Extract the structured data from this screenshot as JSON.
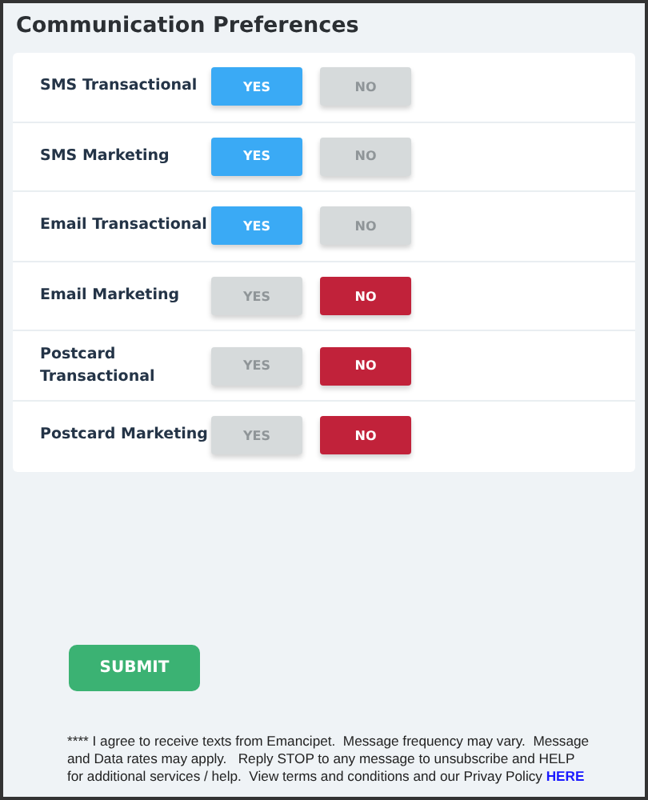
{
  "title": "Communication Preferences",
  "preferences": [
    {
      "label": "SMS Transactional",
      "options": [
        {
          "label": "YES",
          "kind": "yes",
          "selected": true
        },
        {
          "label": "NO",
          "kind": "no",
          "selected": false
        }
      ]
    },
    {
      "label": "SMS Marketing",
      "options": [
        {
          "label": "YES",
          "kind": "yes",
          "selected": true
        },
        {
          "label": "NO",
          "kind": "no",
          "selected": false
        }
      ]
    },
    {
      "label": "Email Transactional",
      "options": [
        {
          "label": "YES",
          "kind": "yes",
          "selected": true
        },
        {
          "label": "NO",
          "kind": "no",
          "selected": false
        }
      ]
    },
    {
      "label": "Email Marketing",
      "options": [
        {
          "label": "YES",
          "kind": "yes",
          "selected": false
        },
        {
          "label": "NO",
          "kind": "no",
          "selected": true
        }
      ]
    },
    {
      "label": "Postcard Transactional",
      "options": [
        {
          "label": "YES",
          "kind": "yes",
          "selected": false
        },
        {
          "label": "NO",
          "kind": "no",
          "selected": true
        }
      ]
    },
    {
      "label": "Postcard Marketing",
      "options": [
        {
          "label": "YES",
          "kind": "yes",
          "selected": false
        },
        {
          "label": "NO",
          "kind": "no",
          "selected": true
        }
      ]
    }
  ],
  "submit": "SUBMIT",
  "disclaimer": {
    "text": "**** I agree to receive texts from Emancipet.  Message frequency may vary.  Message and Data rates may apply.   Reply STOP to any message to unsubscribe and HELP for additional services / help.  View terms and conditions and our Privay Policy",
    "link": "HERE"
  }
}
